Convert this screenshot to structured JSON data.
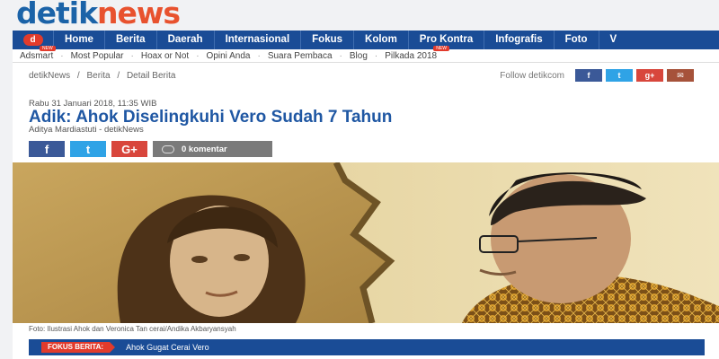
{
  "logo": {
    "part1": "detik",
    "part2": "news"
  },
  "nav": {
    "home_icon": "d",
    "items": [
      "Home",
      "Berita",
      "Daerah",
      "Internasional",
      "Fokus",
      "Kolom",
      "Pro Kontra",
      "Infografis",
      "Foto",
      "V"
    ]
  },
  "subnav": {
    "items": [
      {
        "label": "Adsmart",
        "badge": "NEW"
      },
      {
        "label": "Most Popular"
      },
      {
        "label": "Hoax or Not"
      },
      {
        "label": "Opini Anda"
      },
      {
        "label": "Suara Pembaca"
      },
      {
        "label": "Blog"
      },
      {
        "label": "Pilkada 2018",
        "badge": "NEW"
      }
    ]
  },
  "breadcrumb": {
    "items": [
      "detikNews",
      "/",
      "Berita",
      "/",
      "Detail Berita"
    ]
  },
  "follow": {
    "label": "Follow detikcom",
    "buttons": [
      "f",
      "t",
      "g+",
      "✉"
    ]
  },
  "article": {
    "date": "Rabu 31 Januari 2018, 11:35 WIB",
    "title": "Adik: Ahok Diselingkuhi Vero Sudah 7 Tahun",
    "author": "Aditya Mardiastuti - detikNews",
    "share": {
      "fb": "f",
      "tw": "t",
      "gp": "G+",
      "comments": "0 komentar"
    },
    "caption": "Foto: Ilustrasi Ahok dan Veronica Tan cerai/Andika Akbaryansyah"
  },
  "focus": {
    "label": "FOKUS BERITA:",
    "link": "Ahok Gugat Cerai Vero"
  },
  "colors": {
    "brand_blue": "#1a4c96",
    "accent_red": "#e23b2c",
    "title_blue": "#1f57a3"
  }
}
